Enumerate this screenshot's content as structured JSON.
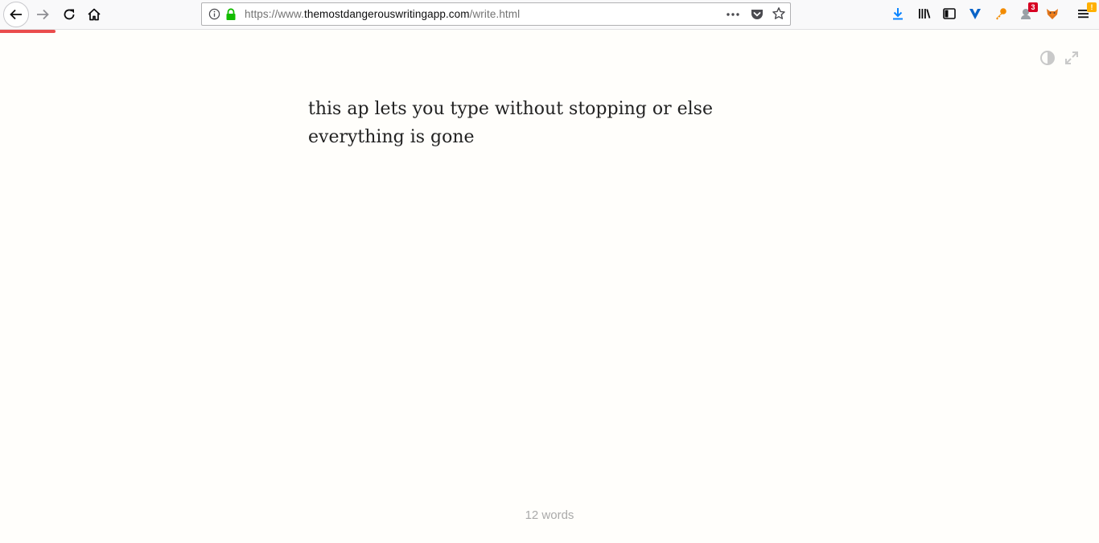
{
  "browser": {
    "url_prefix": "https://www.",
    "url_domain": "themostdangerouswritingapp.com",
    "url_path": "/write.html",
    "notification_count": "3",
    "menu_alert": "!"
  },
  "editor": {
    "text": "this ap lets you type without stopping or else everything is gone"
  },
  "footer": {
    "word_count": "12 words"
  },
  "colors": {
    "progress": "#ea4c4c",
    "lock": "#12bc00",
    "download": "#0a84ff"
  }
}
